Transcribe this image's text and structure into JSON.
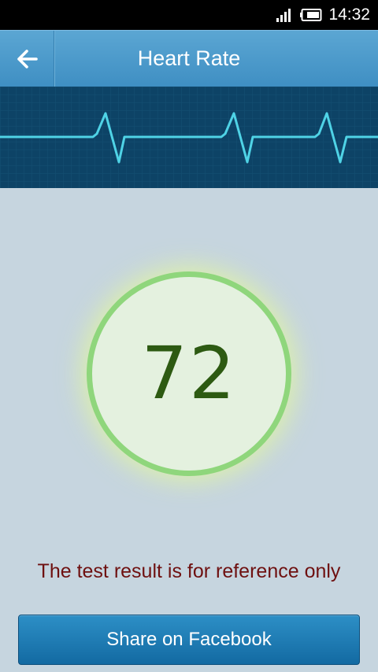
{
  "status_bar": {
    "time": "14:32",
    "icons": [
      "signal-icon",
      "battery-icon"
    ]
  },
  "header": {
    "title": "Heart Rate",
    "back_icon": "arrow-left-icon"
  },
  "ecg": {
    "line_color": "#4fd3e6",
    "background_color": "#0d4366"
  },
  "result": {
    "value": "72",
    "ring_color": "#8fd67c",
    "text_color": "#2d5a12"
  },
  "disclaimer": "The test result is for reference only",
  "share_button": {
    "label": "Share on Facebook"
  },
  "colors": {
    "header": "#4a9acb",
    "page_background": "#c6d5df",
    "disclaimer_text": "#6e1010",
    "button": "#1d7cb5"
  }
}
